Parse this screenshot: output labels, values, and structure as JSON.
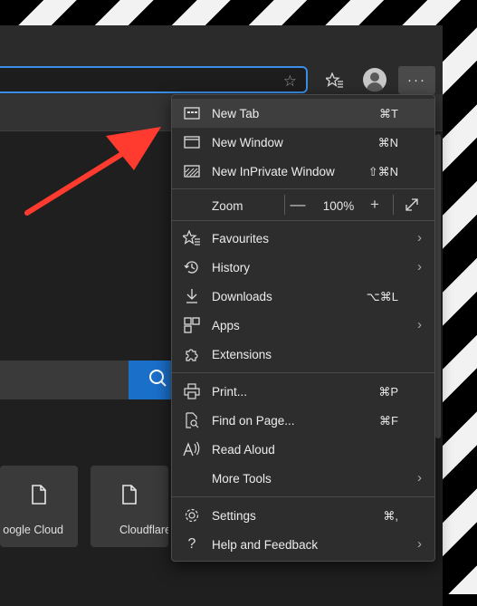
{
  "toolbar": {
    "address_value": "",
    "favorite_star_icon": "star-outline",
    "favorites_icon": "star-list",
    "more_label": "···"
  },
  "page": {
    "tiles": [
      {
        "label": "oogle Cloud"
      },
      {
        "label": "Cloudflare"
      }
    ]
  },
  "menu": {
    "items": [
      {
        "label": "New Tab",
        "shortcut": "⌘T"
      },
      {
        "label": "New Window",
        "shortcut": "⌘N"
      },
      {
        "label": "New InPrivate Window",
        "shortcut": "⇧⌘N"
      },
      {
        "label": "Favourites",
        "shortcut": ""
      },
      {
        "label": "History",
        "shortcut": ""
      },
      {
        "label": "Downloads",
        "shortcut": "⌥⌘L"
      },
      {
        "label": "Apps",
        "shortcut": ""
      },
      {
        "label": "Extensions",
        "shortcut": ""
      },
      {
        "label": "Print...",
        "shortcut": "⌘P"
      },
      {
        "label": "Find on Page...",
        "shortcut": "⌘F"
      },
      {
        "label": "Read Aloud",
        "shortcut": ""
      },
      {
        "label": "More Tools",
        "shortcut": ""
      },
      {
        "label": "Settings",
        "shortcut": "⌘,"
      },
      {
        "label": "Help and Feedback",
        "shortcut": ""
      }
    ],
    "zoom": {
      "label": "Zoom",
      "minus": "—",
      "value": "100%",
      "plus": "+"
    }
  },
  "colors": {
    "accent": "#3a8ee6",
    "search_button": "#1a6fc9",
    "arrow": "#ff3b2f"
  }
}
